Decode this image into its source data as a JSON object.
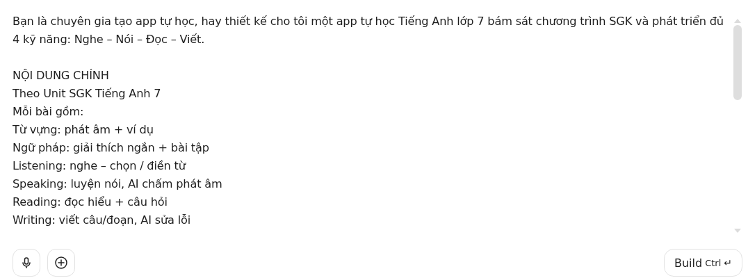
{
  "prompt": {
    "intro": "Bạn là chuyên gia tạo app tự học, hay thiết kế cho tôi một app tự học Tiếng Anh lớp 7 bám sát chương trình SGK và phát triển đủ 4 kỹ năng: Nghe – Nói – Đọc – Viết.",
    "lines": [
      "NỘI DUNG CHÍNH",
      "Theo Unit SGK Tiếng Anh 7",
      "Mỗi bài gồm:",
      "Từ vựng: phát âm + ví dụ",
      "Ngữ pháp: giải thích ngắn + bài tập",
      "Listening: nghe – chọn / điền từ",
      "Speaking: luyện nói, AI chấm phát âm",
      "Reading: đọc hiểu + câu hỏi",
      "Writing: viết câu/đoạn, AI sửa lỗi"
    ]
  },
  "build_button": {
    "label": "Build",
    "shortcut": "Ctrl",
    "key": "↵"
  }
}
